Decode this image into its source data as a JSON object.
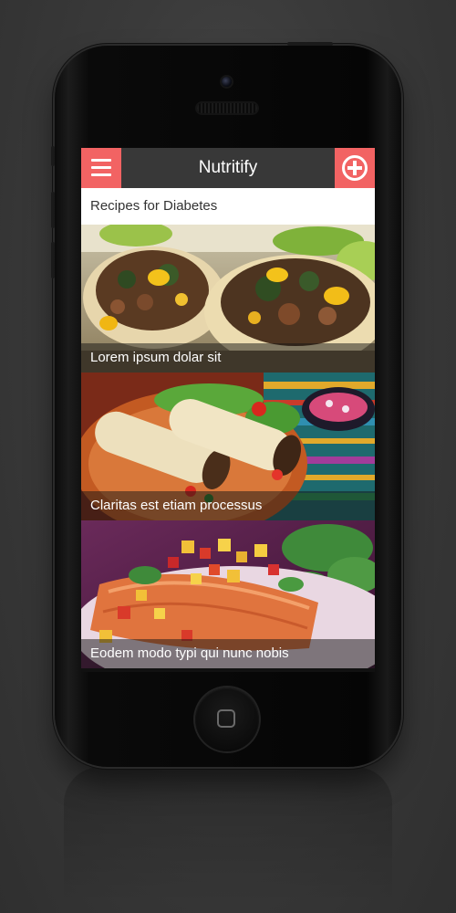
{
  "app": {
    "title": "Nutritify",
    "menu_icon": "hamburger-menu-icon",
    "add_icon": "plus-circle-icon",
    "accent_color": "#f26363",
    "bar_color": "#383838"
  },
  "section": {
    "title": "Recipes for Diabetes"
  },
  "recipes": [
    {
      "title": "Lorem ipsum dolar sit",
      "image": "burrito-wraps-photo"
    },
    {
      "title": "Claritas est etiam processus",
      "image": "tortilla-wraps-plate-photo"
    },
    {
      "title": "Eodem modo typi qui nunc nobis",
      "image": "salmon-mango-salsa-photo"
    }
  ]
}
